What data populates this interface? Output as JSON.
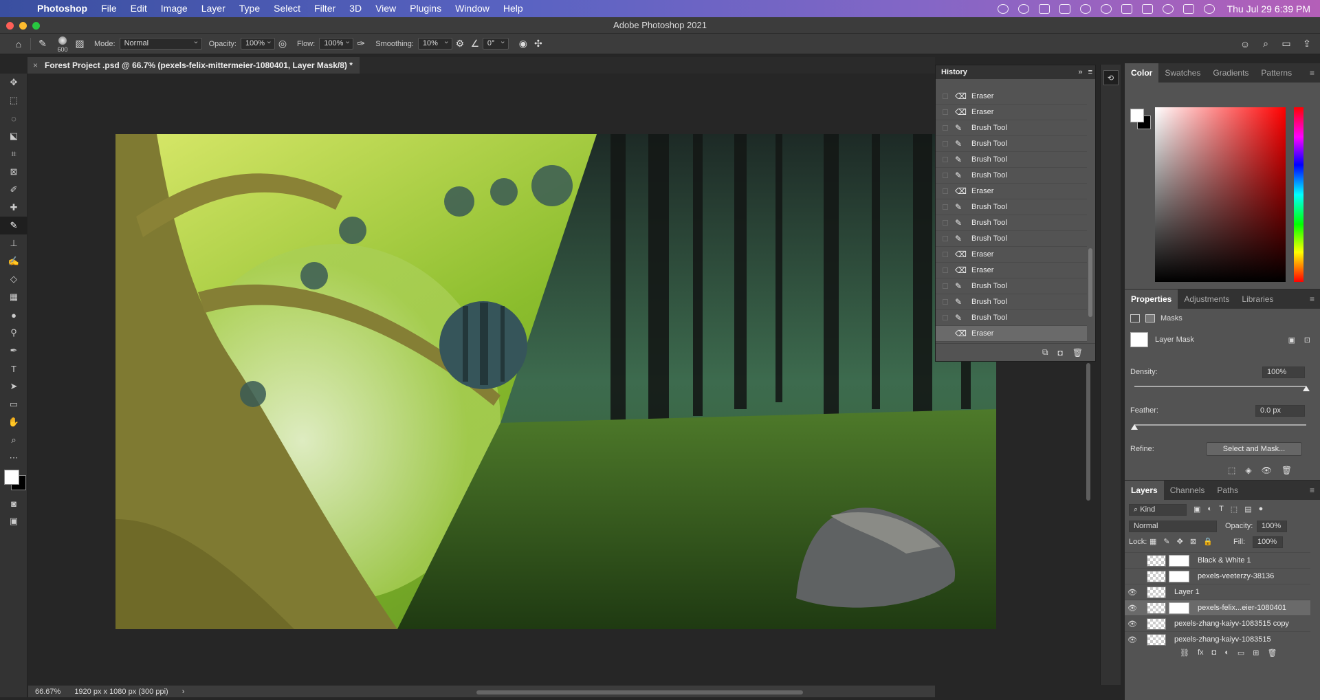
{
  "menubar": {
    "app": "Photoshop",
    "items": [
      "File",
      "Edit",
      "Image",
      "Layer",
      "Type",
      "Select",
      "Filter",
      "3D",
      "View",
      "Plugins",
      "Window",
      "Help"
    ],
    "clock": "Thu Jul 29  6:39 PM"
  },
  "window": {
    "title": "Adobe Photoshop 2021"
  },
  "options": {
    "brush_size": "600",
    "mode_label": "Mode:",
    "mode_value": "Normal",
    "opacity_label": "Opacity:",
    "opacity_value": "100%",
    "flow_label": "Flow:",
    "flow_value": "100%",
    "smoothing_label": "Smoothing:",
    "smoothing_value": "10%",
    "angle_value": "0°"
  },
  "document": {
    "tab_title": "Forest Project .psd @ 66.7% (pexels-felix-mittermeier-1080401, Layer Mask/8) *"
  },
  "history": {
    "title": "History",
    "items": [
      "Eraser",
      "Eraser",
      "Brush Tool",
      "Brush Tool",
      "Brush Tool",
      "Brush Tool",
      "Eraser",
      "Brush Tool",
      "Brush Tool",
      "Brush Tool",
      "Eraser",
      "Eraser",
      "Brush Tool",
      "Brush Tool",
      "Brush Tool",
      "Eraser"
    ],
    "active_index": 15
  },
  "color_panel": {
    "tabs": [
      "Color",
      "Swatches",
      "Gradients",
      "Patterns"
    ],
    "fg": "#ffffff",
    "bg": "#000000"
  },
  "properties": {
    "tabs": [
      "Properties",
      "Adjustments",
      "Libraries"
    ],
    "section": "Masks",
    "mask_name": "Layer Mask",
    "density_label": "Density:",
    "density_value": "100%",
    "density_level": 1.0,
    "feather_label": "Feather:",
    "feather_value": "0.0 px",
    "refine_label": "Refine:",
    "select_and_mask": "Select and Mask..."
  },
  "layers": {
    "tabs": [
      "Layers",
      "Channels",
      "Paths"
    ],
    "filter_kind": "Kind",
    "blend": "Normal",
    "opacity_label": "Opacity:",
    "opacity": "100%",
    "lock_label": "Lock:",
    "fill_label": "Fill:",
    "fill": "100%",
    "items": [
      {
        "name": "Black & White 1",
        "visible": false,
        "mask": true
      },
      {
        "name": "pexels-veeterzy-38136",
        "visible": false,
        "mask": true
      },
      {
        "name": "Layer 1",
        "visible": true,
        "mask": false
      },
      {
        "name": "pexels-felix...eier-1080401",
        "visible": true,
        "mask": true,
        "selected": true
      },
      {
        "name": "pexels-zhang-kaiyv-1083515 copy",
        "visible": true,
        "mask": false
      },
      {
        "name": "pexels-zhang-kaiyv-1083515",
        "visible": true,
        "mask": false
      }
    ]
  },
  "status": {
    "zoom": "66.67%",
    "info": "1920 px x 1080 px (300 ppi)"
  }
}
